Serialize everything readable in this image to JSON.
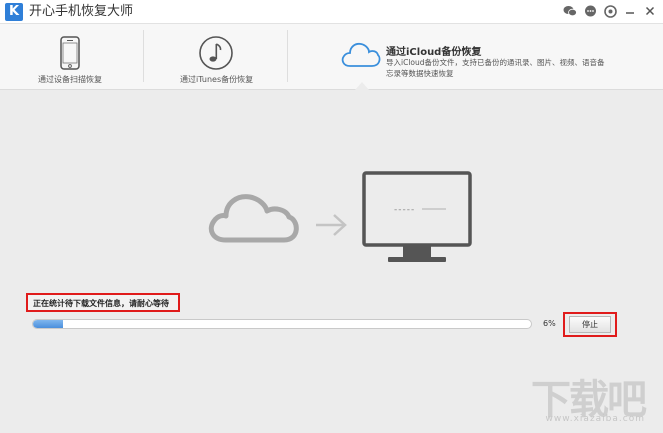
{
  "app": {
    "logo_letter": "K",
    "title": "开心手机恢复大师",
    "title_icons": [
      "wechat-icon",
      "chat-icon",
      "settings-icon",
      "minimize-icon",
      "close-icon"
    ]
  },
  "tabs": [
    {
      "id": "device",
      "label": "通过设备扫描恢复",
      "icon": "phone-icon",
      "active": false
    },
    {
      "id": "itunes",
      "label": "通过iTunes备份恢复",
      "icon": "music-note-icon",
      "active": false
    },
    {
      "id": "icloud",
      "title": "通过iCloud备份恢复",
      "description": "导入iCloud备份文件，支持已备份的通讯录、图片、视频、语音备忘录等数据快速恢复",
      "icon": "cloud-icon",
      "active": true
    }
  ],
  "illustration": {
    "icons": [
      "cloud-icon",
      "arrow-right-icon",
      "monitor-icon"
    ],
    "monitor_text": "-----"
  },
  "progress": {
    "status_text": "正在统计待下载文件信息，请耐心等待",
    "percent_value": 6,
    "percent_text": "6%",
    "stop_label": "停止"
  },
  "colors": {
    "accent_blue": "#4a8fdc",
    "highlight_red": "#e01b1b",
    "background": "#ececec"
  },
  "watermark": {
    "text": "下载吧",
    "sub": "www.xiazaiba.com"
  }
}
